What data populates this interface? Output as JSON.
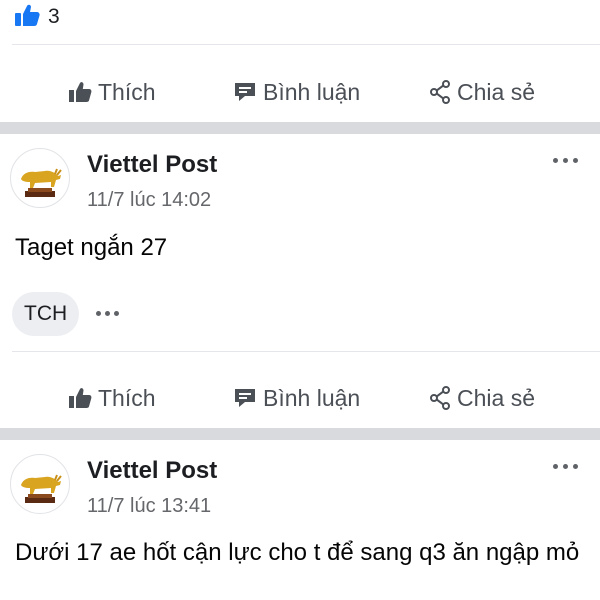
{
  "top_post": {
    "like_count": "3"
  },
  "actions": {
    "like_label": "Thích",
    "comment_label": "Bình luận",
    "share_label": "Chia sẻ"
  },
  "posts": [
    {
      "page_name": "Viettel Post",
      "timestamp": "11/7 lúc 14:02",
      "text": "Taget ngắn 27",
      "tag_chip": "TCH"
    },
    {
      "page_name": "Viettel Post",
      "timestamp": "11/7 lúc 13:41",
      "text": "Dưới 17 ae hốt cận lực cho t để sang q3 ăn ngập mỏ"
    }
  ],
  "colors": {
    "like_blue": "#1877f2",
    "icon_gray": "#4b4f56",
    "separator": "#d9dadd"
  },
  "icons": [
    "thumbs-up-icon",
    "comment-icon",
    "share-icon",
    "more-icon",
    "bull-logo"
  ]
}
